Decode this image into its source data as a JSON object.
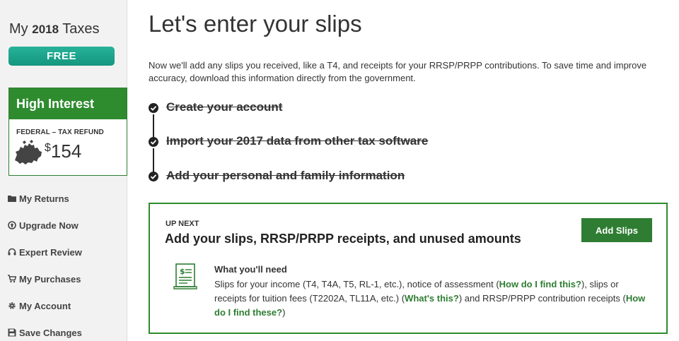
{
  "sidebar": {
    "brand_prefix": "My",
    "brand_year": "2018",
    "brand_suffix": "Taxes",
    "plan_badge": "FREE",
    "refund_card": {
      "heading": "High Interest",
      "label": "FEDERAL – TAX REFUND",
      "currency_symbol": "$",
      "amount": "154"
    },
    "nav": [
      {
        "label": "My Returns",
        "icon": "folder-icon"
      },
      {
        "label": "Upgrade Now",
        "icon": "arrow-up-circle-icon"
      },
      {
        "label": "Expert Review",
        "icon": "headset-icon"
      },
      {
        "label": "My Purchases",
        "icon": "cart-icon"
      },
      {
        "label": "My Account",
        "icon": "gear-icon"
      },
      {
        "label": "Save Changes",
        "icon": "floppy-disk-icon"
      }
    ]
  },
  "main": {
    "title": "Let's enter your slips",
    "intro": "Now we'll add any slips you received, like a T4, and receipts for your RRSP/PRPP contributions. To save time and improve accuracy, download this information directly from the government.",
    "completed_steps": [
      "Create your account",
      "Import your 2017 data from other tax software",
      "Add your personal and family information"
    ],
    "up_next": {
      "label": "UP NEXT",
      "title": "Add your slips, RRSP/PRPP receipts, and unused amounts",
      "button": "Add Slips",
      "need_title": "What you'll need",
      "need_text_1": "Slips for your income (T4, T4A, T5, RL-1, etc.), notice of assessment (",
      "link_1": "How do I find this?",
      "need_text_2": "), slips or receipts for tuition fees (T2202A, TL11A, etc.) (",
      "link_2": "What's this?",
      "need_text_3": ") and RRSP/PRPP contribution receipts (",
      "link_3": "How do I find these?",
      "need_text_4": ")"
    }
  },
  "colors": {
    "accent_green": "#2e7d32",
    "teal_badge": "#15967f"
  }
}
